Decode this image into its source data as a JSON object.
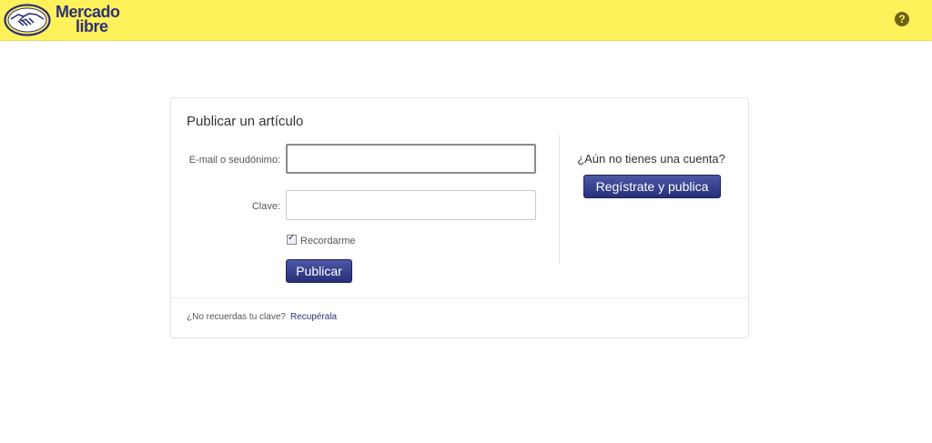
{
  "header": {
    "logo_line1": "Mercado",
    "logo_line2": "libre",
    "help_icon": "help-question-icon"
  },
  "form": {
    "title": "Publicar un artículo",
    "email_label": "E-mail o seudónimo:",
    "email_value": "",
    "password_label": "Clave:",
    "password_value": "",
    "remember_label": "Recordarme",
    "remember_checked": true,
    "submit_label": "Publicar"
  },
  "register": {
    "prompt": "¿Aún no tienes una cuenta?",
    "button_label": "Regístrate y publica"
  },
  "footer": {
    "forgot_text": "¿No recuerdas tu clave?",
    "recover_link": "Recupérala"
  },
  "colors": {
    "header_bg": "#fff159",
    "brand_blue": "#2d3277",
    "button_blue": "#2d3a8c"
  }
}
